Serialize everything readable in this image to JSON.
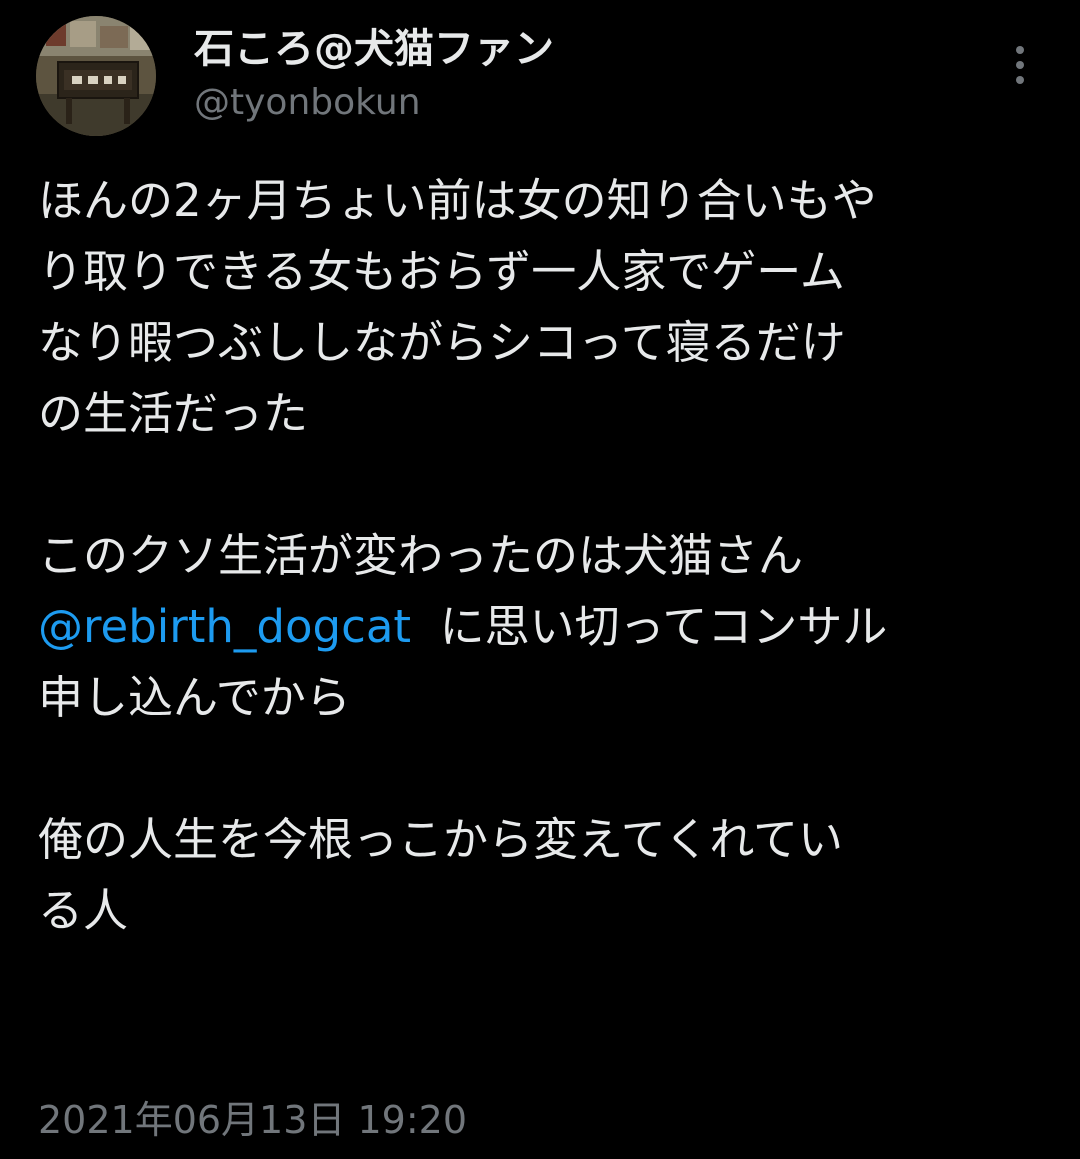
{
  "author": {
    "display_name": "石ころ@犬猫ファン",
    "handle": "@tyonbokun"
  },
  "tweet": {
    "paragraph_1": [
      "ほんの2ヶ月ちょい前は女の知り合いもや",
      "り取りできる女もおらず一人家でゲーム",
      "なり暇つぶししながらシコって寝るだけ",
      "の生活だった"
    ],
    "paragraph_2_line_1": "このクソ生活が変わったのは犬猫さん",
    "mention": "@rebirth_dogcat",
    "paragraph_2_line_2_rest": "に思い切ってコンサル",
    "paragraph_2_line_3": "申し込んでから",
    "paragraph_3": [
      "俺の人生を今根っこから変えてくれてい",
      "る人"
    ],
    "timestamp": "2021年06月13日 19:20"
  },
  "icons": {
    "more": "more-vertical-icon"
  },
  "colors": {
    "background": "#000000",
    "text": "#e7e9ea",
    "secondary": "#71767b",
    "link": "#1d9bf0"
  }
}
